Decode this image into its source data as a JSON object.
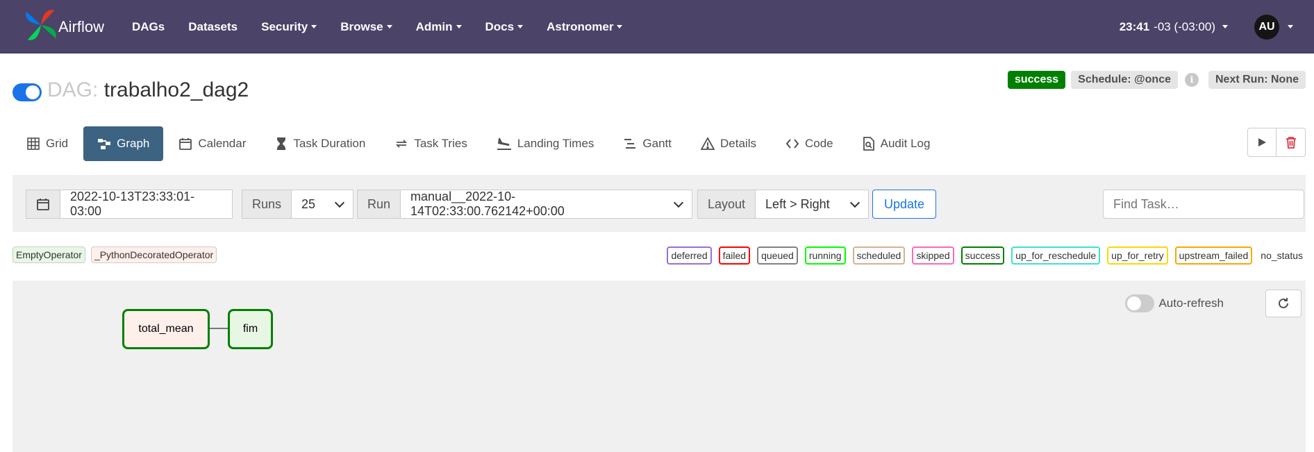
{
  "nav": {
    "brand": "Airflow",
    "items": [
      {
        "label": "DAGs",
        "dropdown": false
      },
      {
        "label": "Datasets",
        "dropdown": false
      },
      {
        "label": "Security",
        "dropdown": true
      },
      {
        "label": "Browse",
        "dropdown": true
      },
      {
        "label": "Admin",
        "dropdown": true
      },
      {
        "label": "Docs",
        "dropdown": true
      },
      {
        "label": "Astronomer",
        "dropdown": true
      }
    ],
    "time": "23:41",
    "timezone": "-03 (-03:00)",
    "user_initials": "AU"
  },
  "dag": {
    "prefix": "DAG:",
    "name": "trabalho2_dag2",
    "paused": false,
    "status_badge": "success",
    "schedule": "Schedule: @once",
    "next_run": "Next Run: None"
  },
  "tabs": [
    {
      "label": "Grid",
      "icon": "grid-icon",
      "active": false
    },
    {
      "label": "Graph",
      "icon": "graph-icon",
      "active": true
    },
    {
      "label": "Calendar",
      "icon": "calendar-icon",
      "active": false
    },
    {
      "label": "Task Duration",
      "icon": "hourglass-icon",
      "active": false
    },
    {
      "label": "Task Tries",
      "icon": "retry-icon",
      "active": false
    },
    {
      "label": "Landing Times",
      "icon": "plane-landing-icon",
      "active": false
    },
    {
      "label": "Gantt",
      "icon": "gantt-icon",
      "active": false
    },
    {
      "label": "Details",
      "icon": "warning-triangle-icon",
      "active": false
    },
    {
      "label": "Code",
      "icon": "code-icon",
      "active": false
    },
    {
      "label": "Audit Log",
      "icon": "file-search-icon",
      "active": false
    }
  ],
  "filters": {
    "base_date": "2022-10-13T23:33:01-03:00",
    "runs_label": "Runs",
    "runs_value": "25",
    "run_label": "Run",
    "run_value": "manual__2022-10-14T02:33:00.762142+00:00",
    "layout_label": "Layout",
    "layout_value": "Left > Right",
    "update_label": "Update",
    "find_task_placeholder": "Find Task…"
  },
  "operators": [
    {
      "label": "EmptyOperator",
      "color": "#e8f7e4"
    },
    {
      "label": "_PythonDecoratedOperator",
      "color": "#ffefeb"
    }
  ],
  "states": [
    {
      "label": "deferred",
      "color": "#9370db"
    },
    {
      "label": "failed",
      "color": "#ff0000"
    },
    {
      "label": "queued",
      "color": "#808080"
    },
    {
      "label": "running",
      "color": "#00ff00"
    },
    {
      "label": "scheduled",
      "color": "#d2b48c"
    },
    {
      "label": "skipped",
      "color": "#ff69b4"
    },
    {
      "label": "success",
      "color": "#008000"
    },
    {
      "label": "up_for_reschedule",
      "color": "#40e0d0"
    },
    {
      "label": "up_for_retry",
      "color": "#ffd700"
    },
    {
      "label": "upstream_failed",
      "color": "#ffa500"
    },
    {
      "label": "no_status",
      "color": null
    }
  ],
  "graph": {
    "auto_refresh_label": "Auto-refresh",
    "auto_refresh_on": false,
    "nodes": [
      {
        "label": "total_mean",
        "state": "success",
        "fill": "#ffefeb"
      },
      {
        "label": "fim",
        "state": "success",
        "fill": "#e8f7e4"
      }
    ]
  },
  "colors": {
    "navbar": "#4c4369",
    "active_tab": "#3c6382",
    "accent": "#1a73e8"
  }
}
